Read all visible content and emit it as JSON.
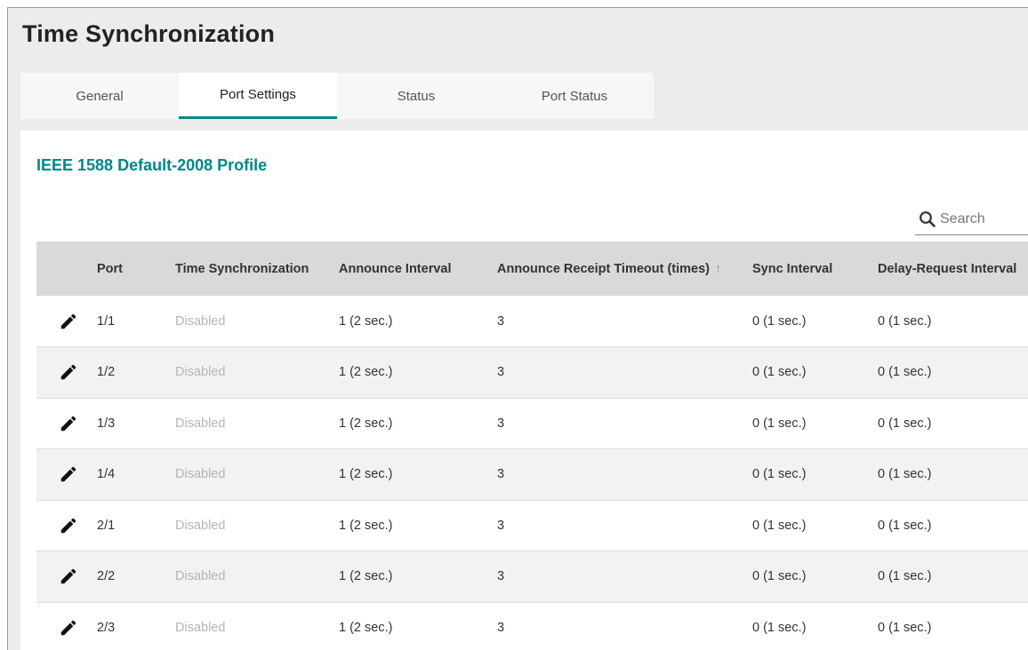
{
  "page": {
    "title": "Time Synchronization"
  },
  "tabs": [
    {
      "label": "General",
      "active": false
    },
    {
      "label": "Port Settings",
      "active": true
    },
    {
      "label": "Status",
      "active": false
    },
    {
      "label": "Port Status",
      "active": false
    }
  ],
  "section": {
    "title": "IEEE 1588 Default-2008 Profile"
  },
  "search": {
    "placeholder": "Search",
    "icon": "search-icon"
  },
  "table": {
    "columns": {
      "port": "Port",
      "time_sync": "Time Synchronization",
      "announce_interval": "Announce Interval",
      "announce_receipt_timeout": "Announce Receipt Timeout (times)",
      "sort_arrow": "↑",
      "sync_interval": "Sync Interval",
      "delay_request_interval": "Delay-Request Interval"
    },
    "rows": [
      {
        "port": "1/1",
        "time_sync": "Disabled",
        "announce_interval": "1 (2 sec.)",
        "announce_receipt_timeout": "3",
        "sync_interval": "0 (1 sec.)",
        "delay_request_interval": "0 (1 sec.)"
      },
      {
        "port": "1/2",
        "time_sync": "Disabled",
        "announce_interval": "1 (2 sec.)",
        "announce_receipt_timeout": "3",
        "sync_interval": "0 (1 sec.)",
        "delay_request_interval": "0 (1 sec.)"
      },
      {
        "port": "1/3",
        "time_sync": "Disabled",
        "announce_interval": "1 (2 sec.)",
        "announce_receipt_timeout": "3",
        "sync_interval": "0 (1 sec.)",
        "delay_request_interval": "0 (1 sec.)"
      },
      {
        "port": "1/4",
        "time_sync": "Disabled",
        "announce_interval": "1 (2 sec.)",
        "announce_receipt_timeout": "3",
        "sync_interval": "0 (1 sec.)",
        "delay_request_interval": "0 (1 sec.)"
      },
      {
        "port": "2/1",
        "time_sync": "Disabled",
        "announce_interval": "1 (2 sec.)",
        "announce_receipt_timeout": "3",
        "sync_interval": "0 (1 sec.)",
        "delay_request_interval": "0 (1 sec.)"
      },
      {
        "port": "2/2",
        "time_sync": "Disabled",
        "announce_interval": "1 (2 sec.)",
        "announce_receipt_timeout": "3",
        "sync_interval": "0 (1 sec.)",
        "delay_request_interval": "0 (1 sec.)"
      },
      {
        "port": "2/3",
        "time_sync": "Disabled",
        "announce_interval": "1 (2 sec.)",
        "announce_receipt_timeout": "3",
        "sync_interval": "0 (1 sec.)",
        "delay_request_interval": "0 (1 sec.)"
      }
    ]
  },
  "colors": {
    "accent": "#008787",
    "disabled_text": "#b5b5b5",
    "header_bg": "#d9d9d9"
  }
}
